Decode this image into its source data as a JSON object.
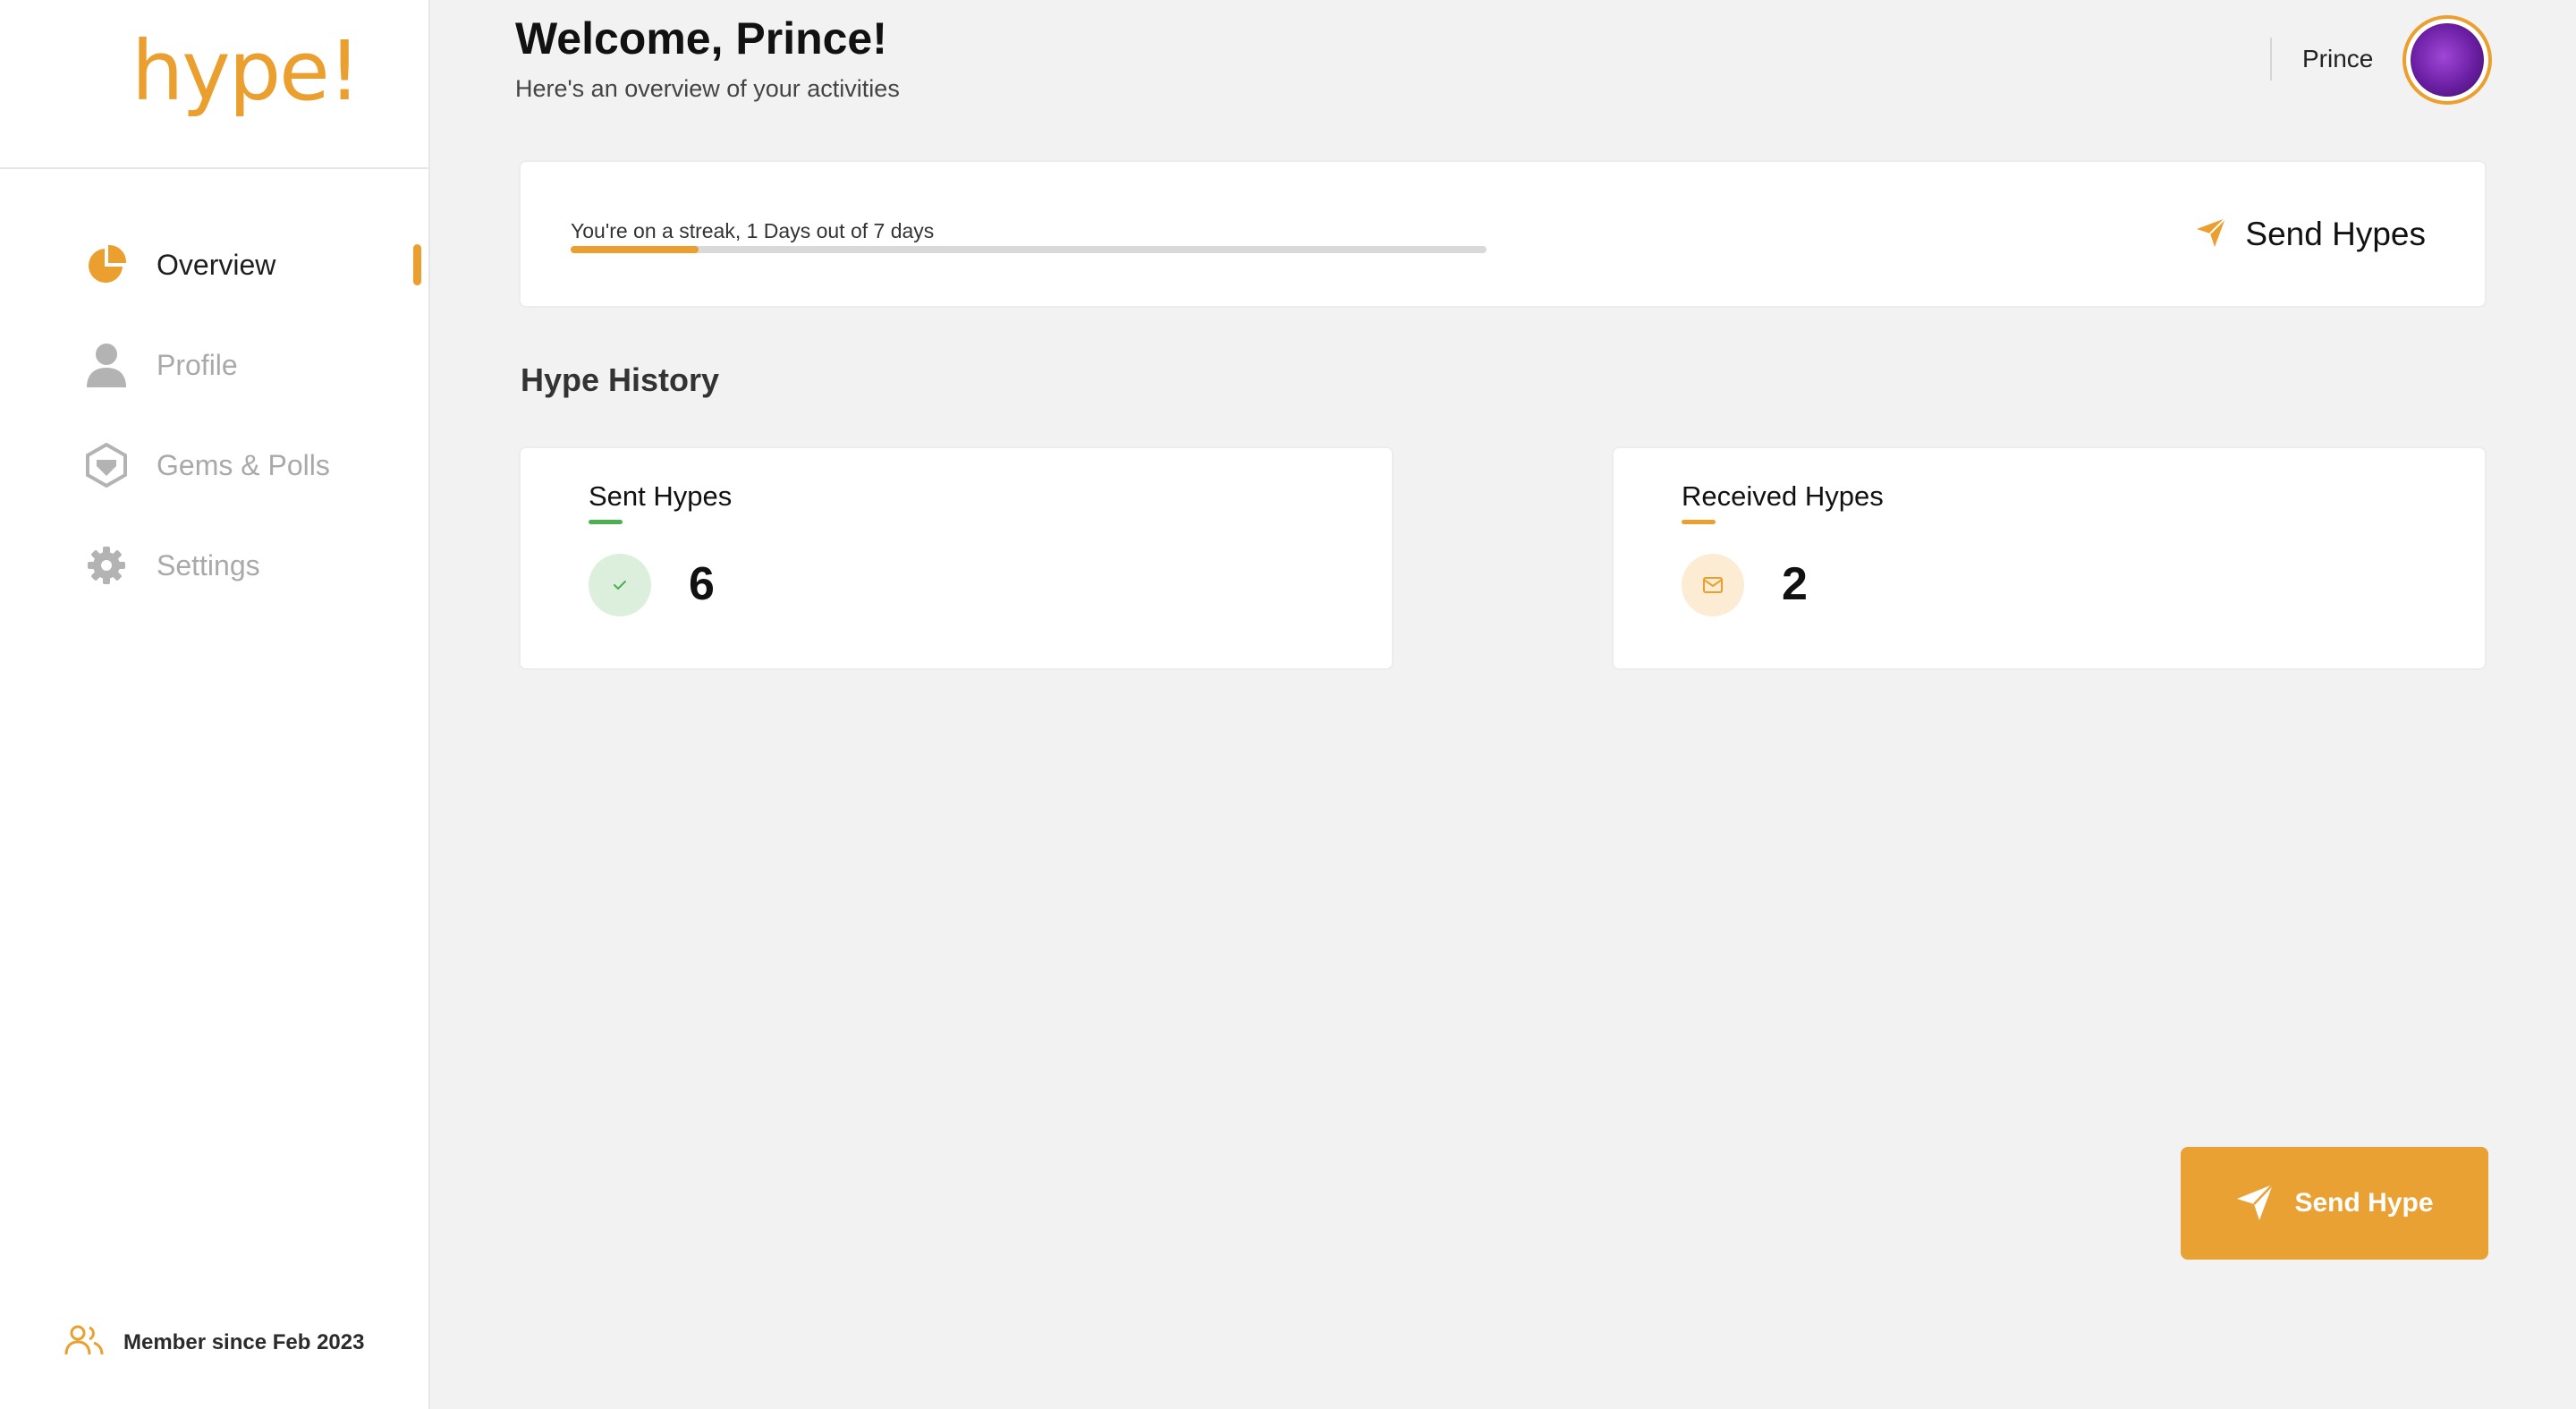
{
  "app": {
    "logo": "hype!"
  },
  "sidebar": {
    "items": [
      {
        "label": "Overview",
        "icon": "pie-chart-icon",
        "active": true
      },
      {
        "label": "Profile",
        "icon": "user-icon",
        "active": false
      },
      {
        "label": "Gems & Polls",
        "icon": "gem-icon",
        "active": false
      },
      {
        "label": "Settings",
        "icon": "gear-icon",
        "active": false
      }
    ],
    "member_since": "Member since Feb 2023"
  },
  "header": {
    "title": "Welcome, Prince!",
    "subtitle": "Here's an overview of your activities",
    "user_name": "Prince"
  },
  "streak": {
    "text": "You're on a streak, 1 Days out of 7 days",
    "progress": 0.14,
    "action_label": "Send Hypes"
  },
  "history": {
    "title": "Hype History",
    "sent": {
      "label": "Sent Hypes",
      "value": "6",
      "icon": "check-icon"
    },
    "received": {
      "label": "Received Hypes",
      "value": "2",
      "icon": "mail-icon"
    }
  },
  "fab": {
    "label": "Send Hype",
    "icon": "send-icon"
  },
  "colors": {
    "accent": "#ea9f2f",
    "sent_accent": "#4caf50",
    "sent_badge_bg": "#dcefdc",
    "received_badge_bg": "#fbecd3",
    "inactive_text": "#a9a9a9"
  }
}
